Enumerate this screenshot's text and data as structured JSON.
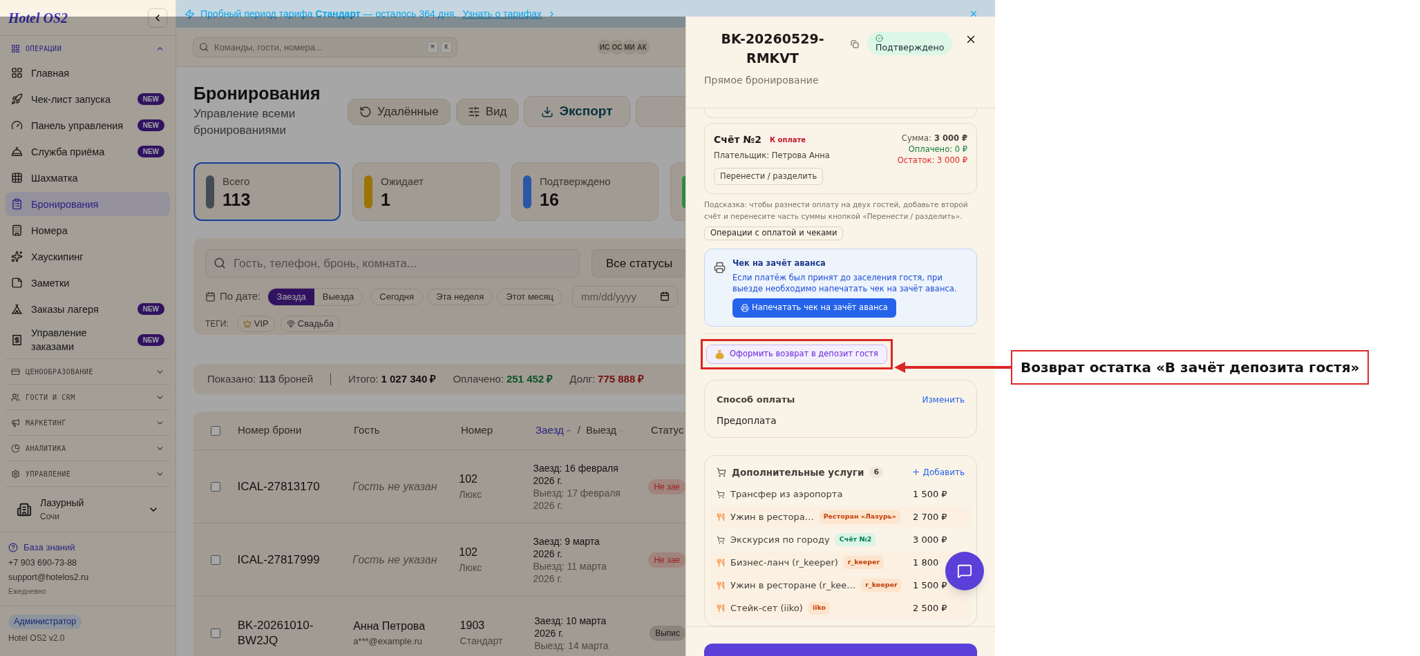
{
  "sidebar": {
    "logo": "Hotel OS2",
    "sections": [
      {
        "title": "ОПЕРАЦИИ",
        "expanded": true,
        "items": [
          {
            "label": "Главная",
            "selected": false
          },
          {
            "label": "Чек-лист запуска",
            "badge": "NEW",
            "selected": false
          },
          {
            "label": "Панель управления",
            "badge": "NEW",
            "selected": false
          },
          {
            "label": "Служба приёма",
            "badge": "NEW",
            "selected": false
          },
          {
            "label": "Шахматка",
            "selected": false
          },
          {
            "label": "Бронирования",
            "selected": true
          },
          {
            "label": "Номера",
            "selected": false
          },
          {
            "label": "Хаускипинг",
            "selected": false
          },
          {
            "label": "Заметки",
            "selected": false
          },
          {
            "label": "Заказы лагеря",
            "badge": "NEW",
            "selected": false
          },
          {
            "label": "Управление заказами",
            "badge": "NEW",
            "selected": false
          }
        ]
      },
      {
        "title": "ЦЕНООБРАЗОВАНИЕ",
        "expanded": false
      },
      {
        "title": "ГОСТИ И CRM",
        "expanded": false
      },
      {
        "title": "МАРКЕТИНГ",
        "expanded": false
      },
      {
        "title": "АНАЛИТИКА",
        "expanded": false
      },
      {
        "title": "УПРАВЛЕНИЕ",
        "expanded": false
      }
    ],
    "property": {
      "name": "Лазурный",
      "city": "Сочи"
    },
    "help": {
      "link": "База знаний",
      "phone": "+7 903 690-73-88",
      "email": "support@hotelos2.ru",
      "hours": "Ежедневно"
    },
    "role": "Администратор",
    "version": "Hotel OS2 v2.0"
  },
  "banner": {
    "text": "Пробный период тарифа **Стандарт** — осталось 364 дня.",
    "link": "Узнать о тарифах"
  },
  "topbar": {
    "search": {
      "placeholder": "Команды, гости, номера..."
    },
    "keys": [
      "⌘",
      "K"
    ],
    "avatars": [
      "ИС",
      "ОС",
      "МИ",
      "АК"
    ]
  },
  "page": {
    "title": "Бронирования",
    "subtitle": "Управление всеми бронированиями",
    "actions": [
      {
        "label": "Удалённые",
        "kind": "restore"
      },
      {
        "label": "Вид",
        "kind": "view"
      },
      {
        "label": "Экспорт",
        "kind": "export"
      }
    ]
  },
  "stats": [
    {
      "label": "Всего",
      "value": "113",
      "color": "#454b55",
      "selected": true
    },
    {
      "label": "Ожидает",
      "value": "1",
      "color": "#9c7306",
      "selected": false
    },
    {
      "label": "Подтверждено",
      "value": "16",
      "color": "#2b57a6",
      "selected": false
    },
    {
      "color": "#2e8b3e",
      "selected": false
    }
  ],
  "filters": {
    "search": {
      "placeholder": "Гость, телефон, бронь, комната..."
    },
    "status": "Все статусы",
    "date_label": "По дате:",
    "date_modes": [
      {
        "label": "Заезда",
        "selected": true
      },
      {
        "label": "Выезда",
        "selected": false
      }
    ],
    "periods": [
      "Сегодня",
      "Эта неделя",
      "Этот месяц"
    ],
    "date": {
      "placeholder": "mm/dd/yyyy"
    },
    "tags_label": "ТЕГИ:",
    "tags": [
      "VIP",
      "Свадьба"
    ]
  },
  "summary": {
    "shown": "Показано: **113** броней",
    "total_label": "Итого:",
    "total": "1 027 340 ₽",
    "paid_label": "Оплачено:",
    "paid": "251 452 ₽",
    "debt_label": "Долг:",
    "debt": "775 888 ₽"
  },
  "table": {
    "all_selected": false,
    "date_separator": "/",
    "columns": [
      "Номер брони",
      "Гость",
      "Номер"
    ],
    "date_columns": [
      {
        "label": "Заезд",
        "selected": true
      },
      {
        "label": "Выезд",
        "selected": false
      }
    ],
    "status_column": "Статус",
    "rows": [
      {
        "id": "ICAL-27813170",
        "guest": "Гость не указан",
        "guest_known": false,
        "room": "102",
        "room_type": "Люкс",
        "checkin": "Заезд: 16 февраля 2026 г.",
        "checkout": "Выезд: 17 февраля 2026 г.",
        "status": "Не зае",
        "color": "#9b1c1c",
        "checked": false
      },
      {
        "id": "ICAL-27817999",
        "guest": "Гость не указан",
        "guest_known": false,
        "room": "102",
        "room_type": "Люкс",
        "checkin": "Заезд: 9 марта 2026 г.",
        "checkout": "Выезд: 11 марта 2026 г.",
        "status": "Не зае",
        "color": "#9b1c1c",
        "checked": false
      },
      {
        "id": "BK-20261010-BW2JQ",
        "guest": "Анна Петрова",
        "guest_known": true,
        "email": "a***@example.ru",
        "room": "1903",
        "room_type": "Стандарт",
        "checkin": "Заезд: 10 марта 2026 г.",
        "checkout": "Выезд: 14 марта",
        "status": "Выпис",
        "color": "#1c1917",
        "checked": false
      }
    ]
  },
  "drawer": {
    "title": "BK-20260529-RMKVT",
    "status": "Подтверждено",
    "source": "Прямое бронирование",
    "invoice": {
      "title": "Счёт №2",
      "badge": "К оплате",
      "payer": "Плательщик: Петрова Анна",
      "sum_label": "Сумма:",
      "sum": "3 000 ₽",
      "paid": "Оплачено: 0 ₽",
      "rest": "Остаток: 3 000 ₽",
      "action": "Перенести / разделить"
    },
    "hint": "Подсказка: чтобы разнести оплату на двух гостей, добавьте второй счёт и перенесите часть суммы кнопкой «Перенести / разделить».",
    "operations": "Операции с оплатой и чеками",
    "advance": {
      "title": "Чек на зачёт аванса",
      "text": "Если платёж был принят до заселения гостя, при выезде необходимо напечатать чек на зачёт аванса.",
      "button": "Напечатать чек на зачёт аванса"
    },
    "refund": "Оформить возврат в депозит гостя",
    "payment": {
      "title": "Способ оплаты",
      "action": "Изменить",
      "value": "Предоплата"
    },
    "services": {
      "title": "Дополнительные услуги",
      "count": "6",
      "action": "Добавить",
      "items": [
        {
          "kind": "cart",
          "name": "Трансфер из аэропорта",
          "price": "1 500 ₽"
        },
        {
          "kind": "dining",
          "name": "Ужин в рестора…",
          "tag": "Ресторан «Лазурь»",
          "color": "#c2410c",
          "price": "2 700 ₽"
        },
        {
          "kind": "cart",
          "name": "Экскурсия по городу",
          "tag": "Счёт №2",
          "color": "#047857",
          "price": "3 000 ₽"
        },
        {
          "kind": "dining",
          "name": "Бизнес-ланч (r_keeper)",
          "tag": "r_keeper",
          "color": "#c2410c",
          "price": "1 800"
        },
        {
          "kind": "dining",
          "name": "Ужин в ресторане (r_kee…",
          "tag": "r_keeper",
          "color": "#c2410c",
          "price": "1 500 ₽"
        },
        {
          "kind": "dining",
          "name": "Стейк-сет (iiko)",
          "tag": "iiko",
          "color": "#c2410c",
          "price": "2 500 ₽"
        }
      ]
    }
  },
  "callout": "Возврат остатка «В зачёт депозита гостя»"
}
